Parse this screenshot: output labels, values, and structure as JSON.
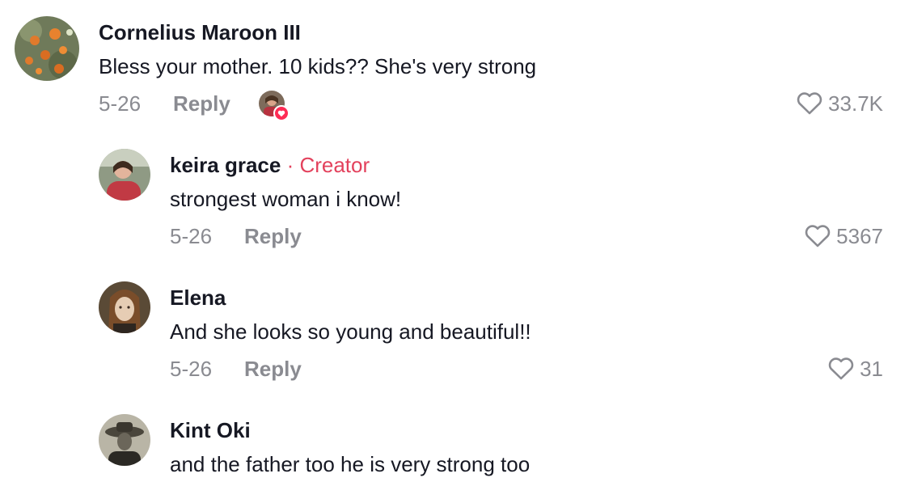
{
  "comments": [
    {
      "author": "Cornelius Maroon III",
      "text": "Bless your mother. 10 kids?? She's very strong",
      "date": "5-26",
      "reply_label": "Reply",
      "likes": "33.7K",
      "liked_by_creator": true
    },
    {
      "author": "keira grace",
      "badge": "· Creator",
      "text": "strongest woman i know!",
      "date": "5-26",
      "reply_label": "Reply",
      "likes": "5367"
    },
    {
      "author": "Elena",
      "text": "And she looks so young and beautiful!!",
      "date": "5-26",
      "reply_label": "Reply",
      "likes": "31"
    },
    {
      "author": "Kint Oki",
      "text": "and the father too he is very strong too"
    }
  ],
  "icons": {
    "like": "heart-outline-icon",
    "creator_liked": "heart-badge-icon"
  },
  "colors": {
    "creator_accent": "#e3415c",
    "meta_gray": "#8a8b91",
    "text": "#161823"
  }
}
